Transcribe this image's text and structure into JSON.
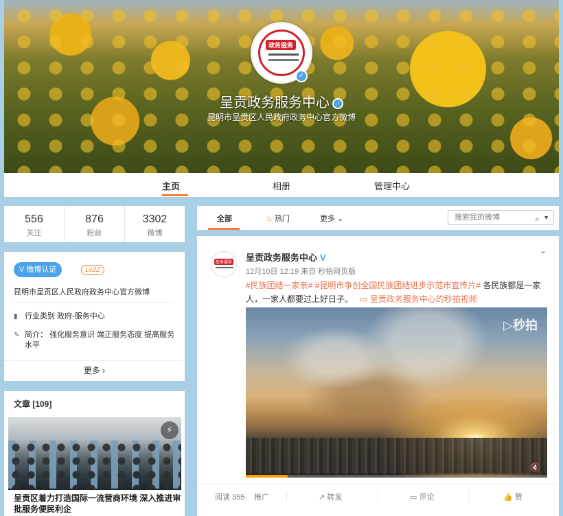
{
  "profile": {
    "name": "呈贡政务服务中心",
    "description": "昆明市呈贡区人民政府政务中心官方微博",
    "avatar_text": "政务服务",
    "verified_icon": "verified-icon"
  },
  "nav": {
    "tabs": [
      {
        "label": "主页",
        "active": true
      },
      {
        "label": "相册",
        "active": false
      },
      {
        "label": "管理中心",
        "active": false
      }
    ]
  },
  "stats": [
    {
      "num": "556",
      "label": "关注"
    },
    {
      "num": "876",
      "label": "粉丝"
    },
    {
      "num": "3302",
      "label": "微博"
    }
  ],
  "info": {
    "verify_badge": "V 微博认证",
    "level": "Lv22",
    "description": "昆明市呈贡区人民政府政务中心官方微博",
    "industry": "行业类别  政府-服务中心",
    "intro": "简介：  强化服务意识 端正服务态度 提高服务水平",
    "more": "更多 ›"
  },
  "article": {
    "title": "文章 [109]",
    "headline": "呈贡区着力打造国际一流营商环境 深入推进审批服务便民利企"
  },
  "feed_tabs": {
    "all": "全部",
    "hot": "热门",
    "more": "更多",
    "search_placeholder": "搜索我的微博"
  },
  "post": {
    "author": "呈贡政务服务中心",
    "time": "12月10日 12:19 来自 秒拍网页版",
    "tag1": "#民族团结一家亲#",
    "tag2": "#昆明市争创全国民族团结进步示范市宣传片#",
    "body": " 各民族都是一家人，一家人都要过上好日子。",
    "video_link": "呈贡政务服务中心的秒拍视频",
    "video_watermark": "秒拍",
    "video_progress": 0.14,
    "reads": "阅读 355",
    "promote": "推广",
    "forward": "转发",
    "comment": "评论",
    "like": "赞"
  },
  "colors": {
    "accent": "#fa7d3c",
    "verified": "#4aa3ea",
    "link": "#eb7350",
    "background": "#a9cfe6"
  }
}
